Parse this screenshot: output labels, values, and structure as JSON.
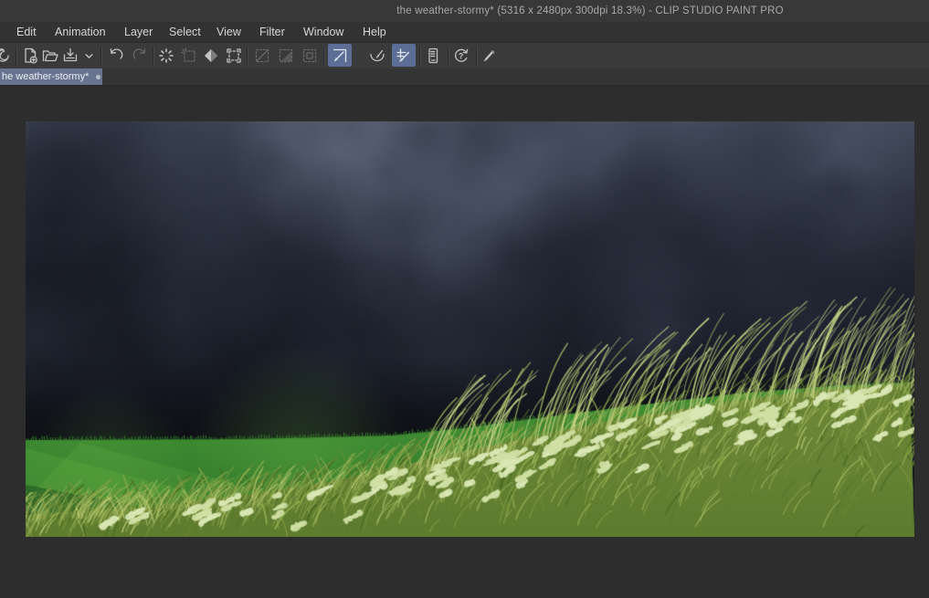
{
  "window": {
    "title": "the weather-stormy* (5316 x 2480px 300dpi 18.3%)  - CLIP STUDIO PAINT PRO",
    "app_name": "CLIP STUDIO PAINT PRO"
  },
  "document": {
    "name": "the weather-stormy*",
    "size": "5316 x 2480px",
    "resolution": "300dpi",
    "zoom": "18.3%",
    "modified": true
  },
  "menubar": {
    "items": [
      "Edit",
      "Animation",
      "Layer",
      "Select",
      "View",
      "Filter",
      "Window",
      "Help"
    ]
  },
  "toolbar": {
    "buttons": [
      {
        "name": "clip-studio-launcher",
        "state": "boxed"
      },
      {
        "name": "new-file",
        "state": "normal"
      },
      {
        "name": "open-file",
        "state": "normal"
      },
      {
        "name": "save",
        "state": "normal"
      },
      {
        "name": "save-options",
        "state": "normal"
      },
      {
        "name": "undo",
        "state": "normal"
      },
      {
        "name": "redo",
        "state": "disabled"
      },
      {
        "name": "deselect",
        "state": "normal"
      },
      {
        "name": "reselect",
        "state": "disabled"
      },
      {
        "name": "invert-selection",
        "state": "normal"
      },
      {
        "name": "selection-border",
        "state": "normal"
      },
      {
        "name": "selection-convert-a",
        "state": "disabled"
      },
      {
        "name": "selection-convert-b",
        "state": "disabled"
      },
      {
        "name": "selection-convert-c",
        "state": "disabled"
      },
      {
        "name": "snap-to-ruler",
        "state": "active"
      },
      {
        "name": "snap-to-special-ruler",
        "state": "normal"
      },
      {
        "name": "snap-to-grid",
        "state": "active"
      },
      {
        "name": "companion-mode",
        "state": "normal"
      },
      {
        "name": "how-to-use",
        "state": "normal"
      },
      {
        "name": "brush",
        "state": "normal"
      }
    ]
  },
  "tabbar": {
    "active_tab": {
      "label": "he weather-stormy*",
      "modified": true
    }
  },
  "colors": {
    "titlebar_bg": "#383838",
    "menubar_bg": "#323232",
    "toolbar_bg": "#3a3a3a",
    "tabstrip_bg": "#343434",
    "tab_active_bg": "#68748f",
    "snap_active_bg": "#5c6e96",
    "workspace_bg": "#2d2d2d"
  },
  "artwork": {
    "description": "digital painting of a stormy dark blue-grey cloudy sky above a green meadow of windblown grass with pale wildflowers rising toward the right",
    "palette": {
      "sky_light": "#5d6678",
      "sky_mid": "#3c4354",
      "sky_dark": "#171a23",
      "field_green": "#3f8d33",
      "grass_olive": "#7e953f",
      "grass_highlight": "#c6d583",
      "flowers": "#d9e7b4"
    }
  }
}
